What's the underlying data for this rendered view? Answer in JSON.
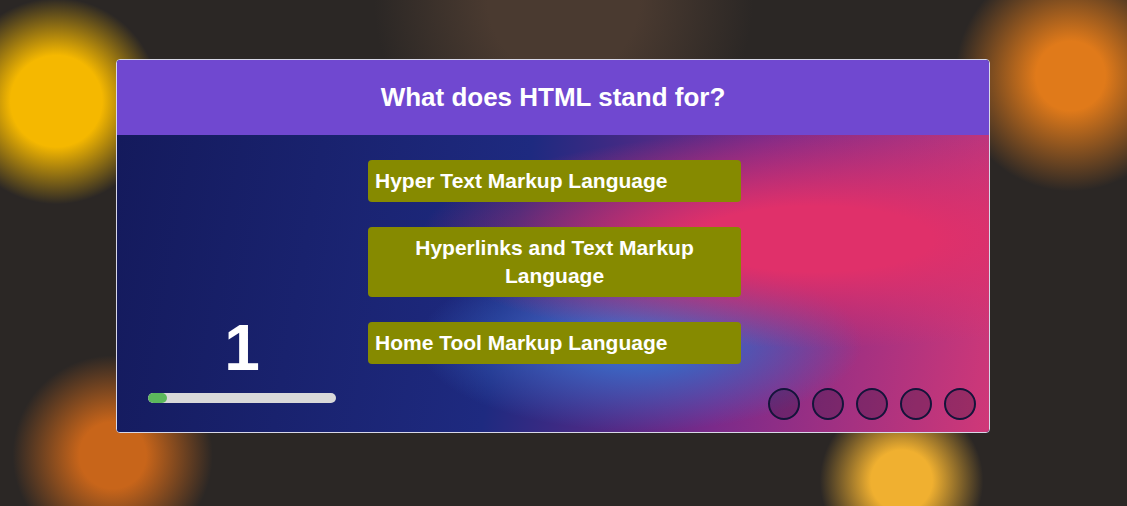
{
  "quiz": {
    "question": "What does HTML stand for?",
    "answers": [
      {
        "text": "Hyper Text Markup Language",
        "align": "left",
        "selected": false
      },
      {
        "text": "Hyperlinks and Text Markup Language",
        "align": "center",
        "selected": false
      },
      {
        "text": "Home Tool Markup Language",
        "align": "left",
        "selected": false
      }
    ],
    "number": "1",
    "progress": {
      "level": 0.1
    },
    "steps": [
      {
        "selected": false
      },
      {
        "selected": false
      },
      {
        "selected": false
      },
      {
        "selected": false
      },
      {
        "selected": false
      }
    ]
  }
}
